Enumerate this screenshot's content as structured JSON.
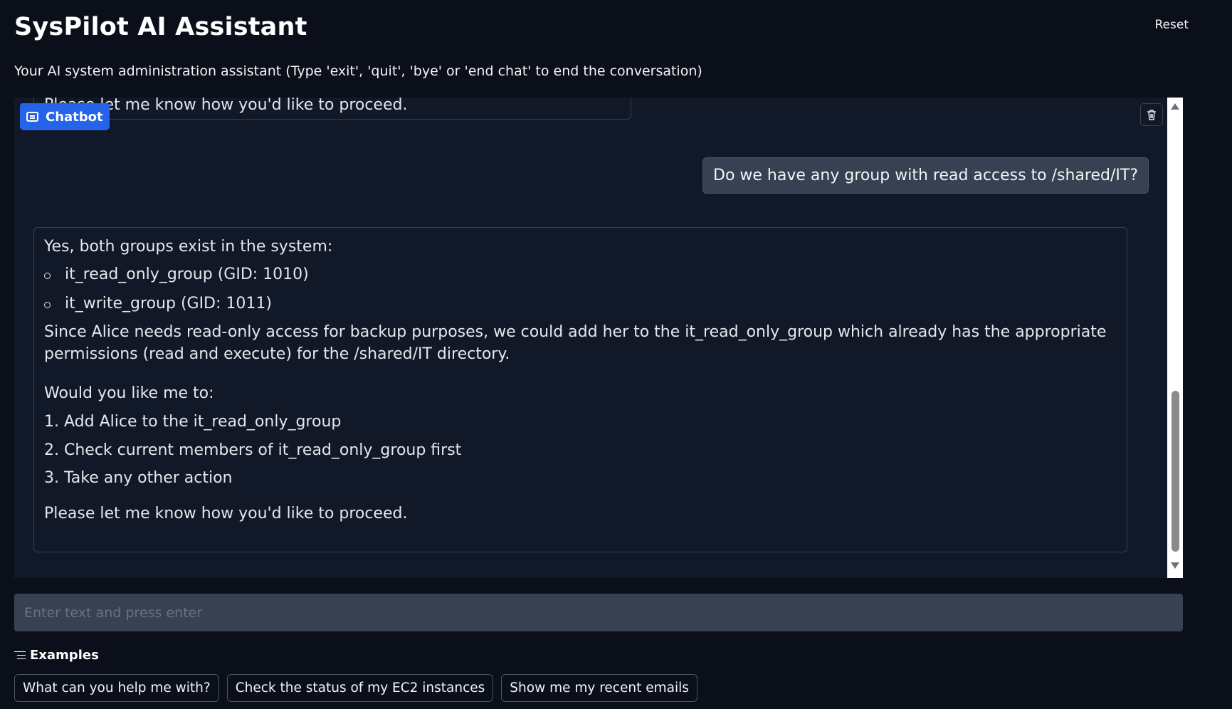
{
  "header": {
    "title": "SysPilot AI Assistant",
    "reset_label": "Reset",
    "subtitle": "Your AI system administration assistant (Type 'exit', 'quit', 'bye' or 'end chat' to end the conversation)"
  },
  "chat": {
    "label": "Chatbot",
    "previous_bot_tail": "Please let me know how you'd like to proceed.",
    "user_message": "Do we have any group with read access to /shared/IT?",
    "bot_reply": {
      "intro": "Yes, both groups exist in the system:",
      "groups": [
        "it_read_only_group (GID: 1010)",
        "it_write_group (GID: 1011)"
      ],
      "explanation": "Since Alice needs read-only access for backup purposes, we could add her to the it_read_only_group which already has the appropriate permissions (read and execute) for the /shared/IT directory.",
      "question": "Would you like me to:",
      "steps": [
        "1. Add Alice to the it_read_only_group",
        "2. Check current members of it_read_only_group first",
        "3. Take any other action"
      ],
      "closing": "Please let me know how you'd like to proceed."
    }
  },
  "input": {
    "placeholder": "Enter text and press enter",
    "value": ""
  },
  "examples": {
    "heading": "Examples",
    "items": [
      "What can you help me with?",
      "Check the status of my EC2 instances",
      "Show me my recent emails"
    ]
  },
  "colors": {
    "background": "#0b0f19",
    "panel": "#111827",
    "accent": "#2563eb",
    "user_bubble": "#374151"
  }
}
